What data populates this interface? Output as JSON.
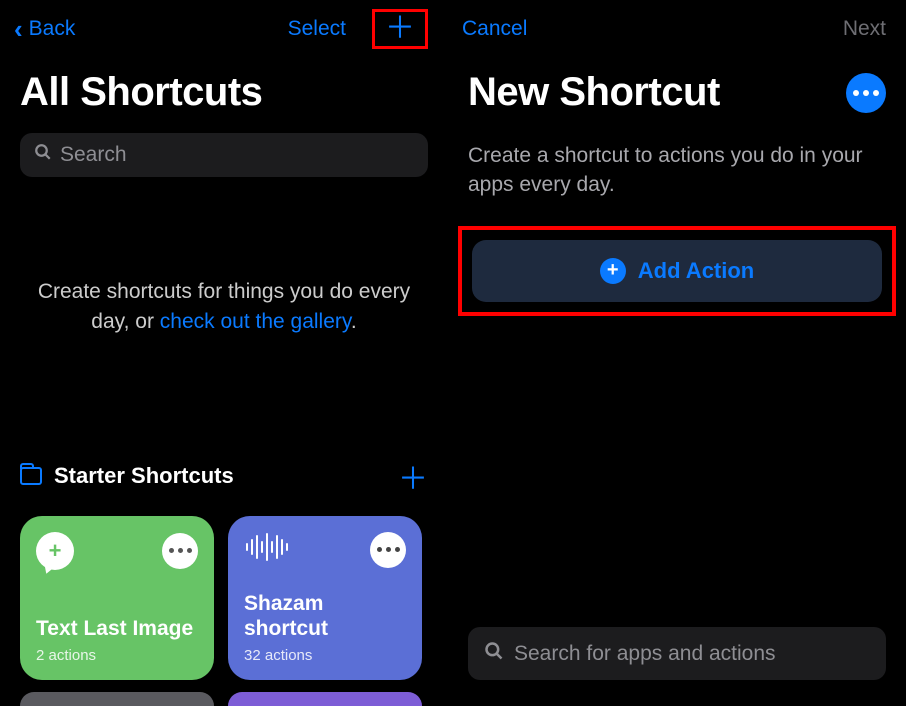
{
  "left": {
    "back": "Back",
    "select": "Select",
    "title": "All Shortcuts",
    "search_placeholder": "Search",
    "empty_prefix": "Create shortcuts for things you do every day, or ",
    "empty_link": "check out the gallery",
    "empty_suffix": ".",
    "section_title": "Starter Shortcuts",
    "cards": [
      {
        "title": "Text Last Image",
        "subtitle": "2 actions"
      },
      {
        "title": "Shazam shortcut",
        "subtitle": "32 actions"
      }
    ]
  },
  "right": {
    "cancel": "Cancel",
    "next": "Next",
    "title": "New Shortcut",
    "description": "Create a shortcut to actions you do in your apps every day.",
    "add_action": "Add Action",
    "search_placeholder": "Search for apps and actions"
  }
}
